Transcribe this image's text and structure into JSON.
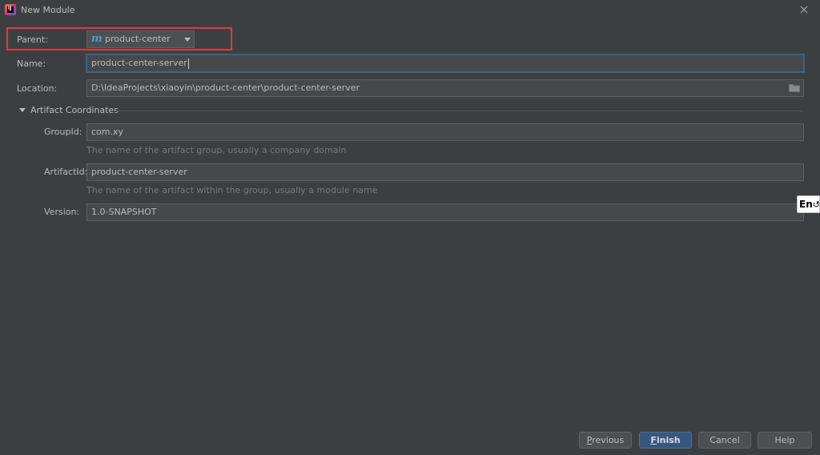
{
  "window": {
    "title": "New Module"
  },
  "form": {
    "parent_label": "Parent:",
    "parent_value": "product-center",
    "name_label": "Name:",
    "name_value": "product-center-server",
    "location_label": "Location:",
    "location_value": "D:\\IdeaProjects\\xiaoyin\\product-center\\product-center-server"
  },
  "artifact": {
    "section_title": "Artifact Coordinates",
    "groupid_label": "GroupId:",
    "groupid_value": "com.xy",
    "groupid_hint": "The name of the artifact group, usually a company domain",
    "artifactid_label": "ArtifactId:",
    "artifactid_value": "product-center-server",
    "artifactid_hint": "The name of the artifact within the group, usually a module name",
    "version_label": "Version:",
    "version_value": "1.0-SNAPSHOT"
  },
  "ime": {
    "label": "En"
  },
  "buttons": {
    "previous_mnemonic": "P",
    "previous_rest": "revious",
    "finish_mnemonic": "F",
    "finish_rest": "inish",
    "cancel": "Cancel",
    "help": "Help"
  },
  "icons": {
    "app": "intellij-icon",
    "close": "close-icon",
    "maven": "maven-module-icon",
    "folder": "folder-icon",
    "expand": "triangle-down-icon"
  },
  "colors": {
    "background": "#3c3f41",
    "field": "#45494a",
    "focus": "#3d6185",
    "highlight": "#e03a3a",
    "default_button": "#365880"
  }
}
